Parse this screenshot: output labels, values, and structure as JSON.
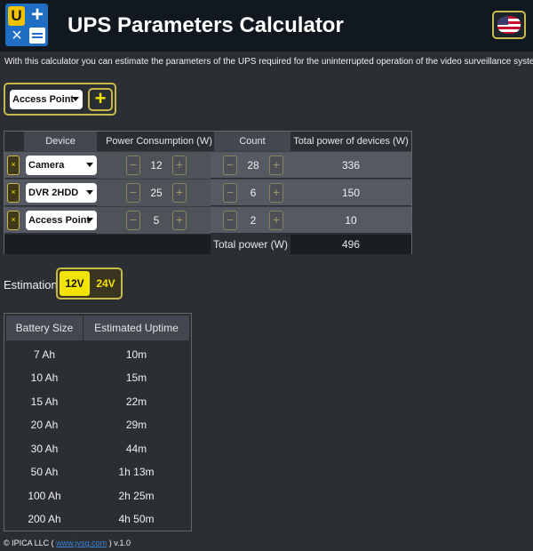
{
  "header": {
    "title": "UPS Parameters Calculator",
    "subtitle": "With this calculator you can estimate the parameters of the UPS required for the uninterrupted operation of the video surveillance system",
    "language_icon": "us-flag-icon"
  },
  "add_device": {
    "selected": "Access Point",
    "add_label": "+"
  },
  "devices_table": {
    "headers": {
      "device": "Device",
      "power": "Power Consumption (W)",
      "count": "Count",
      "total": "Total power of devices (W)"
    },
    "rows": [
      {
        "device": "Camera",
        "power": "12",
        "count": "28",
        "total": "336"
      },
      {
        "device": "DVR 2HDD",
        "power": "25",
        "count": "6",
        "total": "150"
      },
      {
        "device": "Access Point",
        "power": "5",
        "count": "2",
        "total": "10"
      }
    ],
    "total_label": "Total power (W)",
    "total_value": "496",
    "remove_label": "×",
    "minus_label": "−",
    "plus_label": "+"
  },
  "estimation": {
    "label": "Estimation",
    "voltages": [
      "12V",
      "24V"
    ],
    "selected": "12V"
  },
  "battery_table": {
    "headers": {
      "size": "Battery Size",
      "uptime": "Estimated Uptime"
    },
    "rows": [
      {
        "size": "7 Ah",
        "uptime": "10m"
      },
      {
        "size": "10 Ah",
        "uptime": "15m"
      },
      {
        "size": "15 Ah",
        "uptime": "22m"
      },
      {
        "size": "20 Ah",
        "uptime": "29m"
      },
      {
        "size": "30 Ah",
        "uptime": "44m"
      },
      {
        "size": "50 Ah",
        "uptime": "1h 13m"
      },
      {
        "size": "100 Ah",
        "uptime": "2h 25m"
      },
      {
        "size": "200 Ah",
        "uptime": "4h 50m"
      }
    ]
  },
  "footer": {
    "prefix": "© IPICA LLC (",
    "link": "www.jvsg.com",
    "suffix": ") v.1.0"
  },
  "colors": {
    "accent": "#f2e400",
    "border_accent": "#c9b84a",
    "background": "#2b2e33",
    "header_bg": "#111820"
  }
}
